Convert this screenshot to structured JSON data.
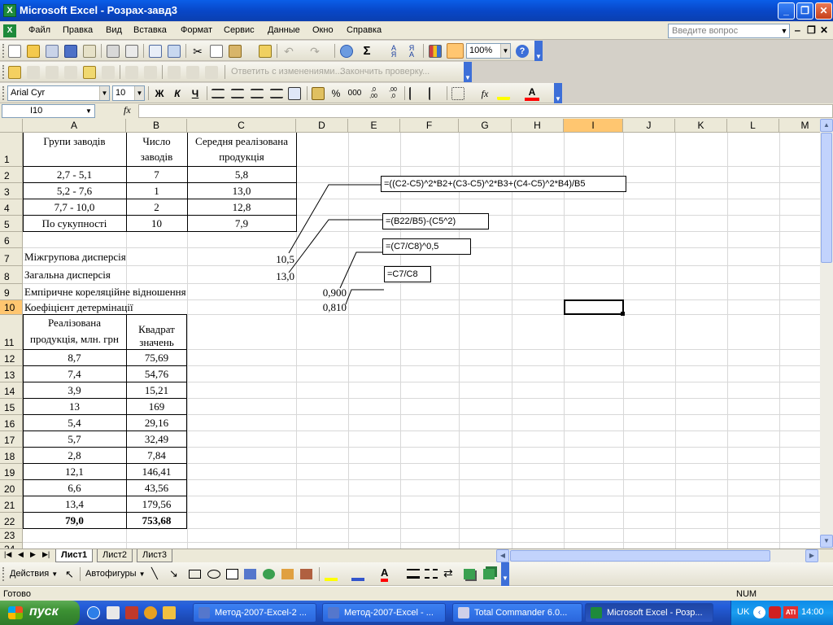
{
  "window": {
    "title": "Microsoft Excel - Розрах-завд3",
    "app_icon": "excel-icon",
    "minimize_icon": "minimize-icon",
    "maximize_icon": "restore-icon",
    "close_icon": "close-icon"
  },
  "menu": {
    "items": [
      "Файл",
      "Правка",
      "Вид",
      "Вставка",
      "Формат",
      "Сервис",
      "Данные",
      "Окно",
      "Справка"
    ],
    "ask_placeholder": "Введите вопрос"
  },
  "toolbar_standard": {
    "zoom": "100%",
    "icons": [
      "new-icon",
      "open-icon",
      "permission-icon",
      "save-icon",
      "email-icon",
      "print-icon",
      "print-preview-icon",
      "spelling-icon",
      "research-icon",
      "cut-icon",
      "copy-icon",
      "paste-icon",
      "format-painter-icon",
      "undo-icon",
      "redo-icon",
      "hyperlink-icon",
      "autosum-icon",
      "sort-asc-icon",
      "sort-desc-icon",
      "chart-wizard-icon",
      "drawing-icon",
      "help-icon"
    ]
  },
  "toolbar_review": {
    "reply_label": "Ответить с изменениями...",
    "end_review_label": "Закончить проверку..."
  },
  "toolbar_formatting": {
    "font": "Arial Cyr",
    "size": "10",
    "bold": "Ж",
    "italic": "К",
    "underline": "Ч",
    "percent": "%",
    "thousands": "000",
    "inc_decimal": ",0→,00",
    "dec_decimal": ",00→,0",
    "function": "fx",
    "font_color_letter": "A"
  },
  "formula_bar": {
    "name_box": "I10",
    "fx": "fx",
    "content": ""
  },
  "columns": [
    "A",
    "B",
    "C",
    "D",
    "E",
    "F",
    "G",
    "H",
    "I",
    "J",
    "K",
    "L",
    "M"
  ],
  "rows": [
    "1",
    "2",
    "3",
    "4",
    "5",
    "6",
    "7",
    "8",
    "9",
    "10",
    "11",
    "12",
    "13",
    "14",
    "15",
    "16",
    "17",
    "18",
    "19",
    "20",
    "21",
    "22",
    "23",
    "24"
  ],
  "selected_cell": "I10",
  "table1": {
    "headers": {
      "a": "Групи заводів",
      "b1": "Число",
      "b2": "заводів",
      "c1": "Середня реалізована",
      "c2": "продукція"
    },
    "rows": [
      [
        "2,7 - 5,1",
        "7",
        "5,8"
      ],
      [
        "5,2 - 7,6",
        "1",
        "13,0"
      ],
      [
        "7,7 - 10,0",
        "2",
        "12,8"
      ],
      [
        "По сукупності",
        "10",
        "7,9"
      ]
    ]
  },
  "stats": [
    {
      "label": "Міжгрупова дисперсія",
      "value": "10,5"
    },
    {
      "label": "Загальна дисперсія",
      "value": "13,0"
    },
    {
      "label": "Емпіричне кореляційне відношення",
      "value": "0,900"
    },
    {
      "label": "Коефіцієнт детермінації",
      "value": "0,810"
    }
  ],
  "formulas": [
    "=((C2-C5)^2*B2+(C3-C5)^2*B3+(C4-C5)^2*B4)/B5",
    "=(B22/B5)-(C5^2)",
    "=(C7/C8)^0,5",
    "=C7/C8"
  ],
  "table2": {
    "headers": {
      "a1": "Реалізована",
      "a2": "продукція, млн. грн",
      "b1": "Квадрат",
      "b2": "значень"
    },
    "rows": [
      [
        "8,7",
        "75,69"
      ],
      [
        "7,4",
        "54,76"
      ],
      [
        "3,9",
        "15,21"
      ],
      [
        "13",
        "169"
      ],
      [
        "5,4",
        "29,16"
      ],
      [
        "5,7",
        "32,49"
      ],
      [
        "2,8",
        "7,84"
      ],
      [
        "12,1",
        "146,41"
      ],
      [
        "6,6",
        "43,56"
      ],
      [
        "13,4",
        "179,56"
      ]
    ],
    "total": [
      "79,0",
      "753,68"
    ]
  },
  "sheets": [
    "Лист1",
    "Лист2",
    "Лист3"
  ],
  "active_sheet": "Лист1",
  "drawing_toolbar": {
    "actions": "Действия",
    "autoshapes": "Автофигуры"
  },
  "status": {
    "ready": "Готово",
    "num": "NUM"
  },
  "taskbar": {
    "start": "пуск",
    "tasks": [
      "Метод-2007-Excel-2 ...",
      "Метод-2007-Excel - ...",
      "Total Commander 6.0...",
      "Microsoft Excel - Розр..."
    ],
    "lang": "UK",
    "clock": "14:00"
  },
  "colors": {
    "title_blue": "#0a5ee8",
    "taskbar_blue": "#245edb",
    "start_green": "#3c9133",
    "selection_orange": "#ffc670"
  }
}
